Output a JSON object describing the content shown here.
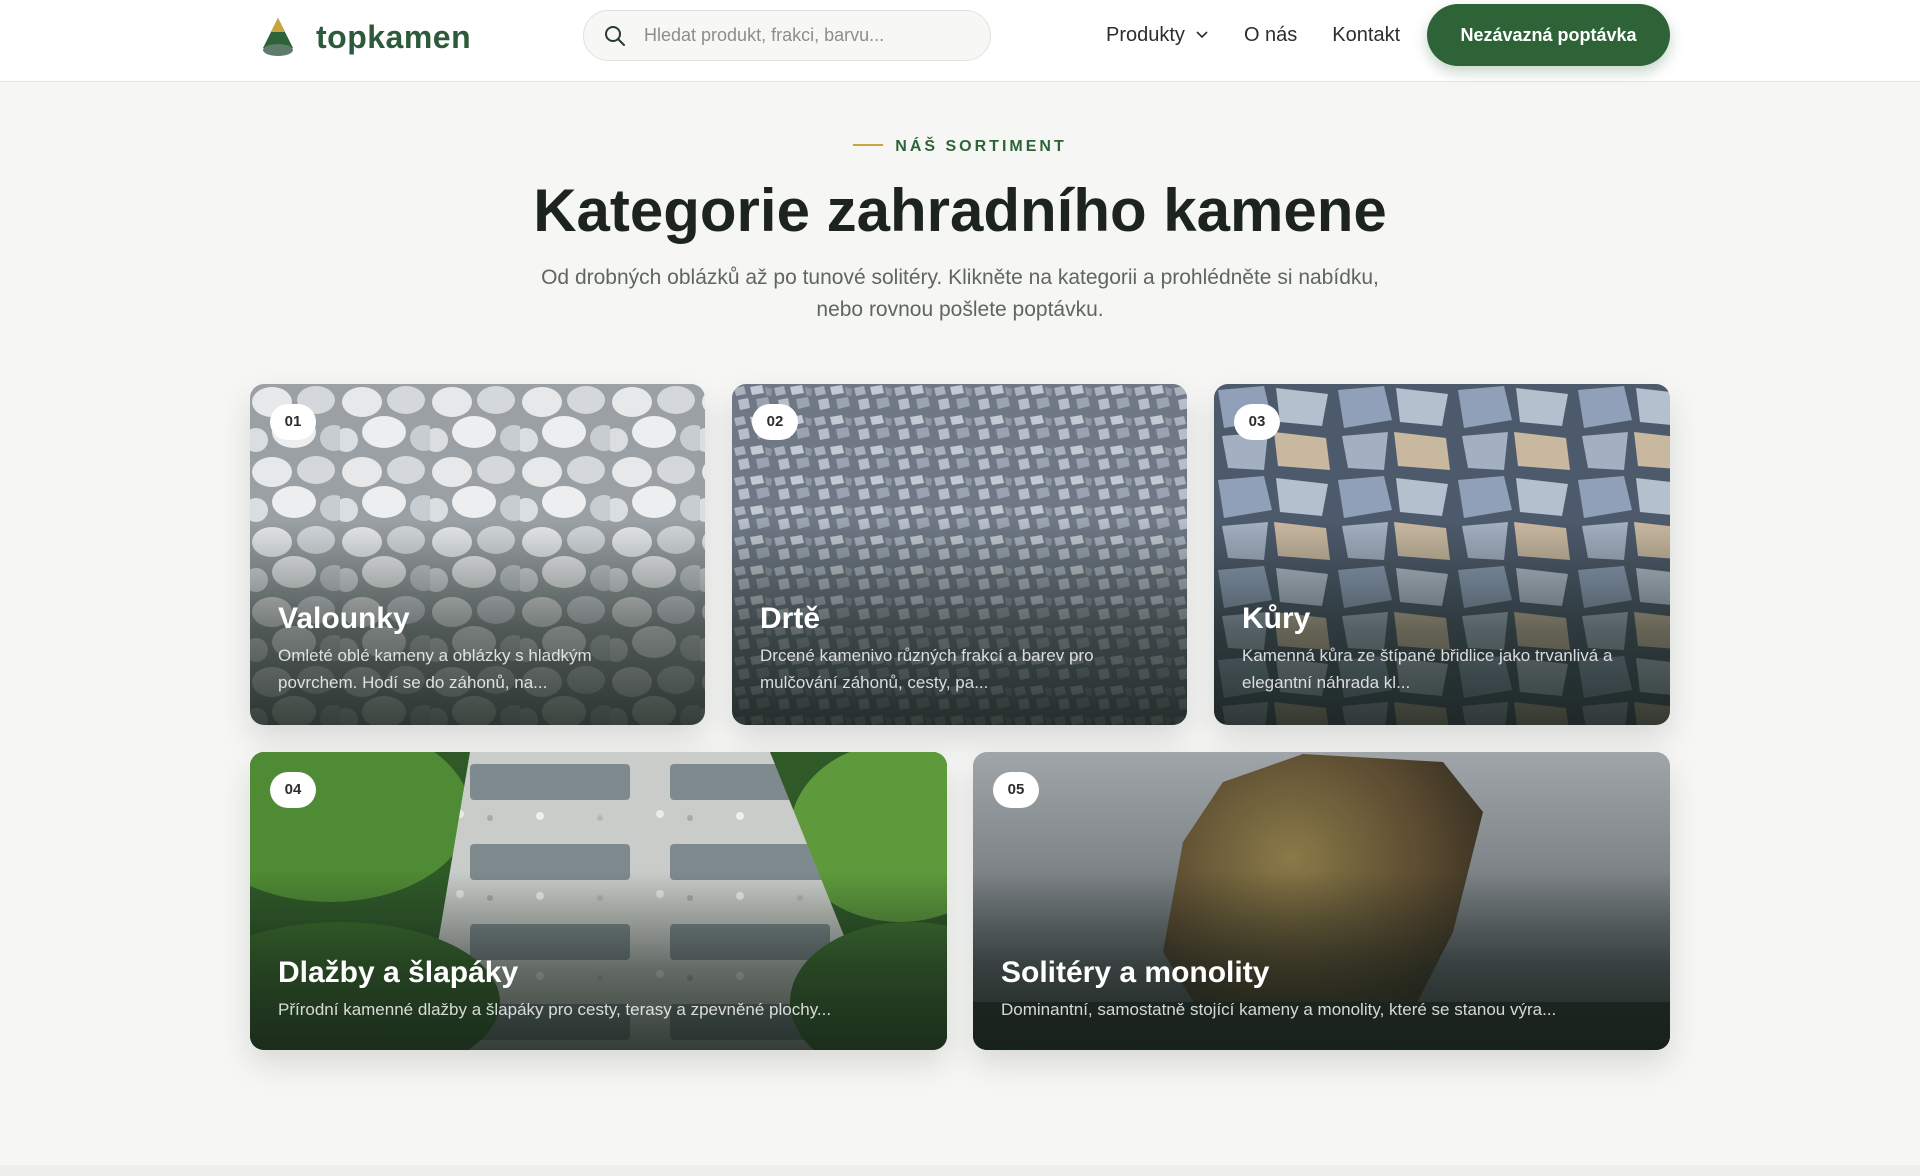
{
  "header": {
    "brand": "topkamen",
    "search_placeholder": "Hledat produkt, frakci, barvu...",
    "nav": [
      "Produkty",
      "O nás",
      "Kontakt"
    ],
    "cta_label": "Nezávazná poptávka"
  },
  "hero": {
    "eyebrow": "NÁŠ SORTIMENT",
    "title": "Kategorie zahradního kamene",
    "subtitle": "Od drobných oblázků až po tunové solitéry. Klikněte na kategorii a prohlédněte si nabídku, nebo rovnou pošlete poptávku."
  },
  "categories": [
    {
      "number": "01",
      "title": "Valounky",
      "description": "Omleté oblé kameny a oblázky s hladkým povrchem. Hodí se do záhonů, na..."
    },
    {
      "number": "02",
      "title": "Drtě",
      "description": "Drcené kamenivo různých frakcí a barev pro mulčování záhonů, cesty, pa..."
    },
    {
      "number": "03",
      "title": "Kůry",
      "description": "Kamenná kůra ze štípané břidlice jako trvanlivá a elegantní náhrada kl..."
    },
    {
      "number": "04",
      "title": "Dlažby a šlapáky",
      "description": "Přírodní kamenné dlažby a šlapáky pro cesty, terasy a zpevněné plochy..."
    },
    {
      "number": "05",
      "title": "Solitéry a monolity",
      "description": "Dominantní, samostatně stojící kameny a monolity, které se stanou výra..."
    }
  ],
  "colors": {
    "brand_green": "#2e6338",
    "accent_gold": "#c9a43f",
    "text_dark": "#1d2420"
  },
  "icons": {
    "logo": "mountain-tree-icon",
    "search": "search-icon",
    "dropdown": "chevron-down-icon"
  }
}
